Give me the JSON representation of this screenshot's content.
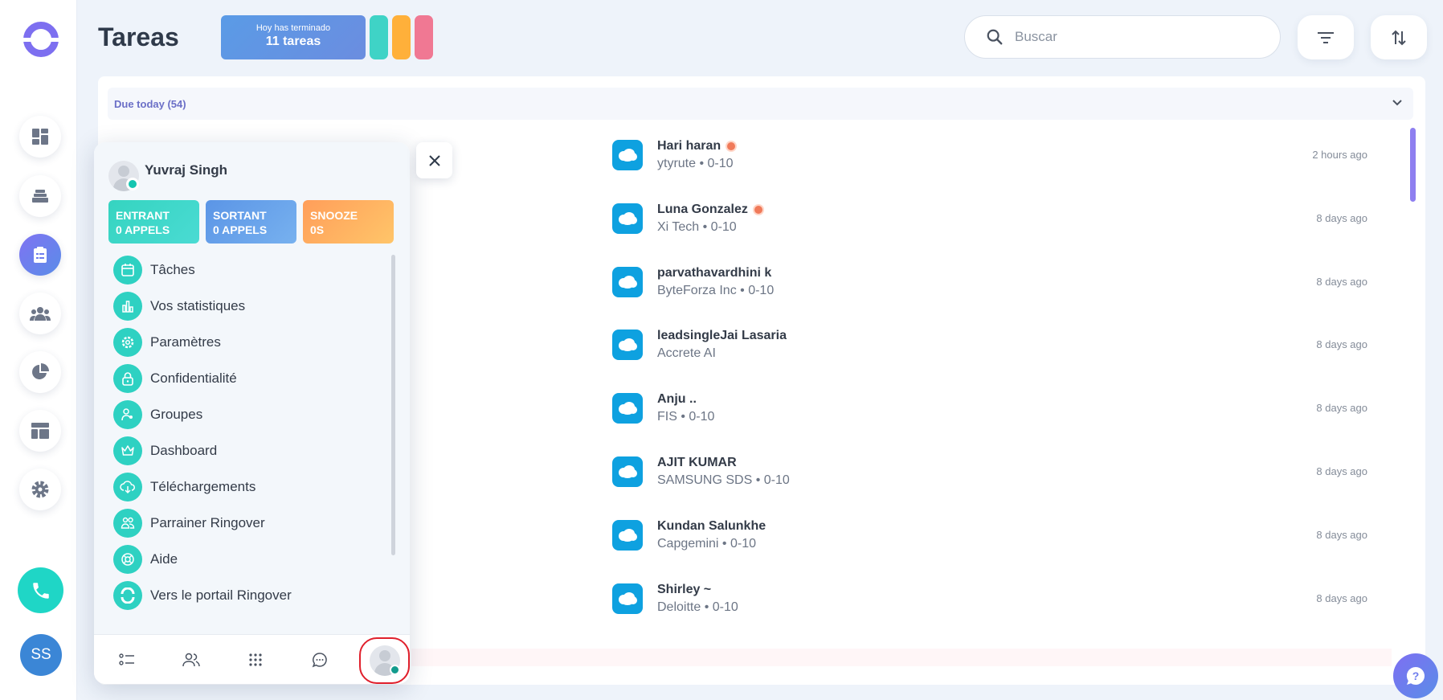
{
  "header": {
    "title": "Tareas",
    "done_card": {
      "line1": "Hoy has terminado",
      "line2": "11 tareas"
    },
    "pills": [
      "#3fd3c6",
      "#ffb03a",
      "#f07893"
    ],
    "search_placeholder": "Buscar"
  },
  "rail": {
    "items": [
      "dashboard-icon",
      "inbox-icon",
      "tasks-icon",
      "people-icon",
      "pie-chart-icon",
      "layout-icon",
      "gear-icon"
    ],
    "active": "tasks-icon",
    "user_initials": "SS"
  },
  "main": {
    "section_label": "Due today (54)",
    "rows": [
      {
        "name": "Hari haran",
        "sub": "ytyrute • 0-10",
        "time": "2 hours ago",
        "flag": true
      },
      {
        "name": "Luna Gonzalez",
        "sub": "Xi Tech • 0-10",
        "time": "8 days ago",
        "flag": true
      },
      {
        "name": "parvathavardhini k",
        "sub": "ByteForza Inc • 0-10",
        "time": "8 days ago",
        "flag": false
      },
      {
        "name": "leadsingleJai Lasaria",
        "sub": "Accrete AI",
        "time": "8 days ago",
        "flag": false
      },
      {
        "name": "Anju ..",
        "sub": "FIS • 0-10",
        "time": "8 days ago",
        "flag": false
      },
      {
        "name": "AJIT KUMAR",
        "sub": "SAMSUNG SDS • 0-10",
        "time": "8 days ago",
        "flag": false
      },
      {
        "name": "Kundan Salunkhe",
        "sub": "Capgemini • 0-10",
        "time": "8 days ago",
        "flag": false
      },
      {
        "name": "Shirley ~",
        "sub": "Deloitte • 0-10",
        "time": "8 days ago",
        "flag": false
      }
    ]
  },
  "popover": {
    "user_name": "Yuvraj Singh",
    "stats": [
      {
        "line1": "ENTRANT",
        "line2": "0 APPELS",
        "from": "#35d4c0",
        "to": "#4adbd3"
      },
      {
        "line1": "SORTANT",
        "line2": "0 APPELS",
        "from": "#5b95e6",
        "to": "#77b1ef"
      },
      {
        "line1": "SNOOZE",
        "line2": "0S",
        "from": "#ff9e5a",
        "to": "#ffc569"
      }
    ],
    "menu": [
      {
        "label": "Tâches",
        "icon": "calendar-icon"
      },
      {
        "label": "Vos statistiques",
        "icon": "bar-chart-icon"
      },
      {
        "label": "Paramètres",
        "icon": "gear-icon"
      },
      {
        "label": "Confidentialité",
        "icon": "lock-icon"
      },
      {
        "label": "Groupes",
        "icon": "group-icon"
      },
      {
        "label": "Dashboard",
        "icon": "crown-icon"
      },
      {
        "label": "Téléchargements",
        "icon": "cloud-download-icon"
      },
      {
        "label": "Parrainer Ringover",
        "icon": "referral-icon"
      },
      {
        "label": "Aide",
        "icon": "lifebuoy-icon"
      },
      {
        "label": "Vers le portail Ringover",
        "icon": "ringover-logo-icon"
      }
    ],
    "footer": [
      "list-icon",
      "contacts-icon",
      "dialpad-icon",
      "chat-icon",
      "profile-avatar"
    ]
  }
}
